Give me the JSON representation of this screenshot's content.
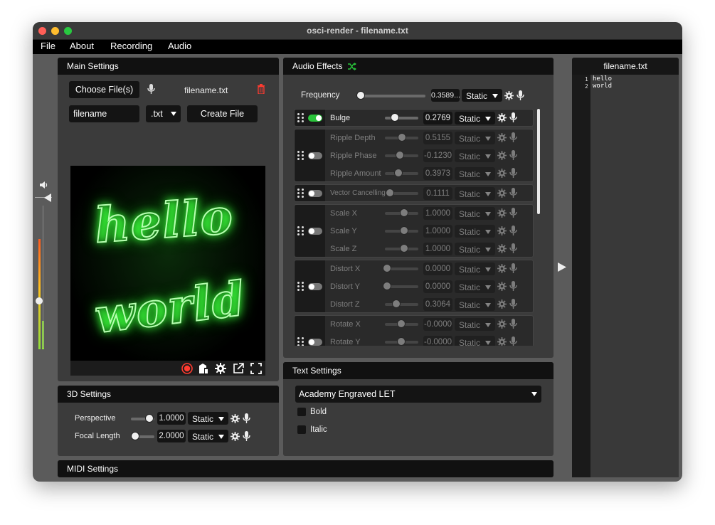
{
  "window": {
    "title": "osci-render - filename.txt"
  },
  "menu": {
    "items": [
      "File",
      "About",
      "Recording",
      "Audio"
    ]
  },
  "main_settings": {
    "header": "Main Settings",
    "choose_button": "Choose File(s)",
    "current_file": "filename.txt",
    "filename_value": "filename",
    "ext_value": ".txt",
    "create_button": "Create File",
    "preview_text_line1": "hello",
    "preview_text_line2": "world"
  },
  "audio_effects": {
    "header": "Audio Effects",
    "frequency": {
      "label": "Frequency",
      "value": "0.3589...",
      "mode": "Static"
    },
    "effects": [
      {
        "label": "Bulge",
        "value": "0.2769",
        "mode": "Static"
      },
      {
        "label": "Ripple Depth",
        "value": "0.5155",
        "mode": "Static"
      },
      {
        "label": "Ripple Phase",
        "value": "-0.1230",
        "mode": "Static"
      },
      {
        "label": "Ripple Amount",
        "value": "0.3973",
        "mode": "Static"
      },
      {
        "label": "Vector Cancelling",
        "value": "0.1111",
        "mode": "Static"
      },
      {
        "label": "Scale X",
        "value": "1.0000",
        "mode": "Static"
      },
      {
        "label": "Scale Y",
        "value": "1.0000",
        "mode": "Static"
      },
      {
        "label": "Scale Z",
        "value": "1.0000",
        "mode": "Static"
      },
      {
        "label": "Distort X",
        "value": "0.0000",
        "mode": "Static"
      },
      {
        "label": "Distort Y",
        "value": "0.0000",
        "mode": "Static"
      },
      {
        "label": "Distort Z",
        "value": "0.3064",
        "mode": "Static"
      },
      {
        "label": "Rotate X",
        "value": "-0.0000",
        "mode": "Static"
      },
      {
        "label": "Rotate Y",
        "value": "-0.0000",
        "mode": "Static"
      }
    ]
  },
  "settings_3d": {
    "header": "3D Settings",
    "perspective": {
      "label": "Perspective",
      "value": "1.0000",
      "mode": "Static"
    },
    "focal_length": {
      "label": "Focal Length",
      "value": "2.0000",
      "mode": "Static"
    }
  },
  "text_settings": {
    "header": "Text Settings",
    "font": "Academy Engraved LET",
    "bold_label": "Bold",
    "italic_label": "Italic"
  },
  "midi": {
    "header": "MIDI Settings"
  },
  "editor": {
    "title": "filename.txt",
    "lines": [
      {
        "num": "1",
        "text": "hello"
      },
      {
        "num": "2",
        "text": "world"
      }
    ]
  },
  "colors": {
    "accent_green": "#29c43a",
    "record_red": "#ff3b30",
    "glow_green": "#7dff7d"
  }
}
